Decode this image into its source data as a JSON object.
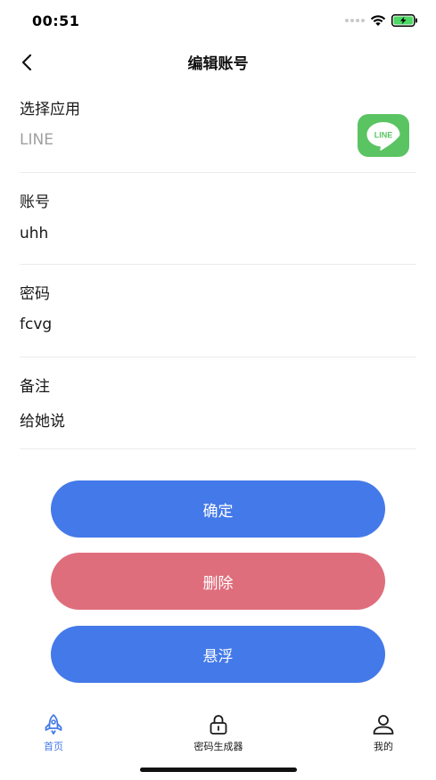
{
  "status_bar": {
    "time": "00:51"
  },
  "nav": {
    "title": "编辑账号"
  },
  "fields": [
    {
      "label": "选择应用",
      "value": "LINE",
      "muted": true,
      "icon": "line-app-icon",
      "icon_text": "LINE"
    },
    {
      "label": "账号",
      "value": "uhh"
    },
    {
      "label": "密码",
      "value": "fcvg"
    },
    {
      "label": "备注",
      "value": "给她说"
    }
  ],
  "buttons": {
    "confirm": "确定",
    "delete": "删除",
    "float": "悬浮"
  },
  "tabs": [
    {
      "label": "首页",
      "icon": "rocket-icon",
      "active": true
    },
    {
      "label": "密码生成器",
      "icon": "lock-icon",
      "active": false
    },
    {
      "label": "我的",
      "icon": "person-icon",
      "active": false
    }
  ],
  "colors": {
    "primary": "#4479e9",
    "danger": "#df6e7d",
    "line_green": "#5ac463",
    "battery_green": "#4cd964"
  }
}
